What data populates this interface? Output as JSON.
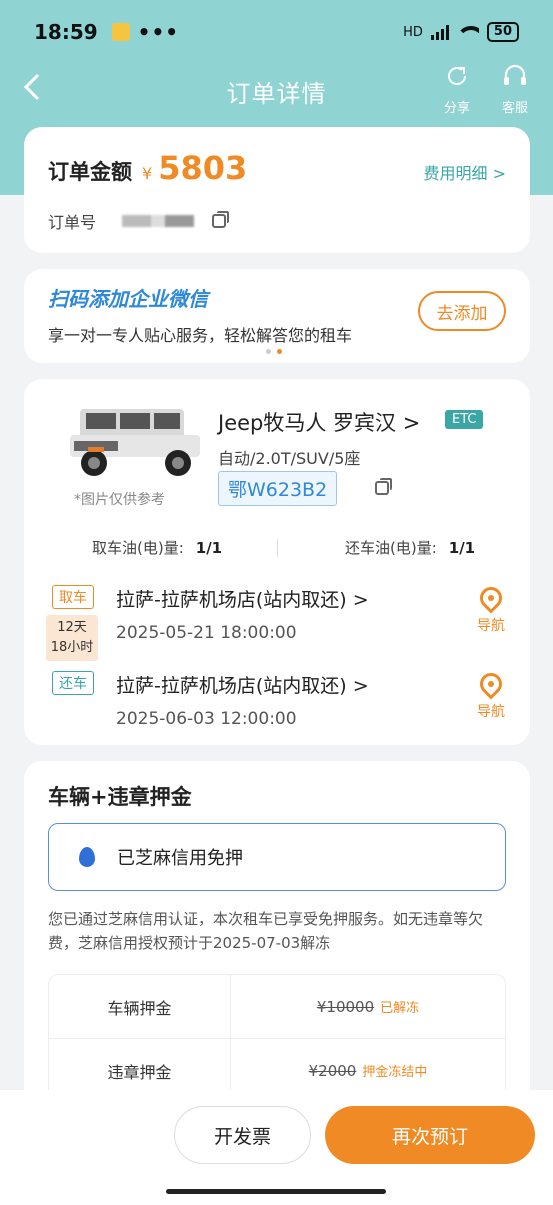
{
  "status_bar": {
    "time": "18:59",
    "dots": "•••",
    "network": "HD",
    "battery": "50"
  },
  "nav": {
    "back_icon": "chevron-left-icon",
    "title": "订单详情",
    "share_label": "分享",
    "service_label": "客服"
  },
  "order": {
    "amount_label": "订单金额",
    "currency": "¥",
    "amount": "5803",
    "fee_detail_label": "费用明细 >",
    "order_no_label": "订单号"
  },
  "wechat_banner": {
    "title": "扫码添加企业微信",
    "subtitle": "享一对一专人贴心服务，轻松解答您的租车",
    "add_button": "去添加"
  },
  "car": {
    "name": "Jeep牧马人 罗宾汉 >",
    "etc": "ETC",
    "spec": "自动/2.0T/SUV/5座",
    "plate": "鄂W623B2",
    "image_note": "*图片仅供参考",
    "fuel_pick_label": "取车油(电)量:",
    "fuel_pick_value": "1/1",
    "fuel_return_label": "还车油(电)量:",
    "fuel_return_value": "1/1"
  },
  "pickup": {
    "tag": "取车",
    "place": "拉萨-拉萨机场店(站内取还) >",
    "time": "2025-05-21 18:00:00",
    "nav_label": "导航"
  },
  "duration": {
    "line1": "12天",
    "line2": "18小时"
  },
  "return": {
    "tag": "还车",
    "place": "拉萨-拉萨机场店(站内取还) >",
    "time": "2025-06-03 12:00:00",
    "nav_label": "导航"
  },
  "deposit": {
    "title": "车辆+违章押金",
    "sesame_text": "已芝麻信用免押",
    "description": "您已通过芝麻信用认证，本次租车已享受免押服务。如无违章等欠费，芝麻信用授权预计于2025-07-03解冻",
    "rows": [
      {
        "name": "车辆押金",
        "amount": "¥10000",
        "status": "已解冻"
      },
      {
        "name": "违章押金",
        "amount": "¥2000",
        "status": "押金冻结中"
      }
    ]
  },
  "bottom": {
    "invoice_button": "开发票",
    "rebook_button": "再次预订"
  }
}
